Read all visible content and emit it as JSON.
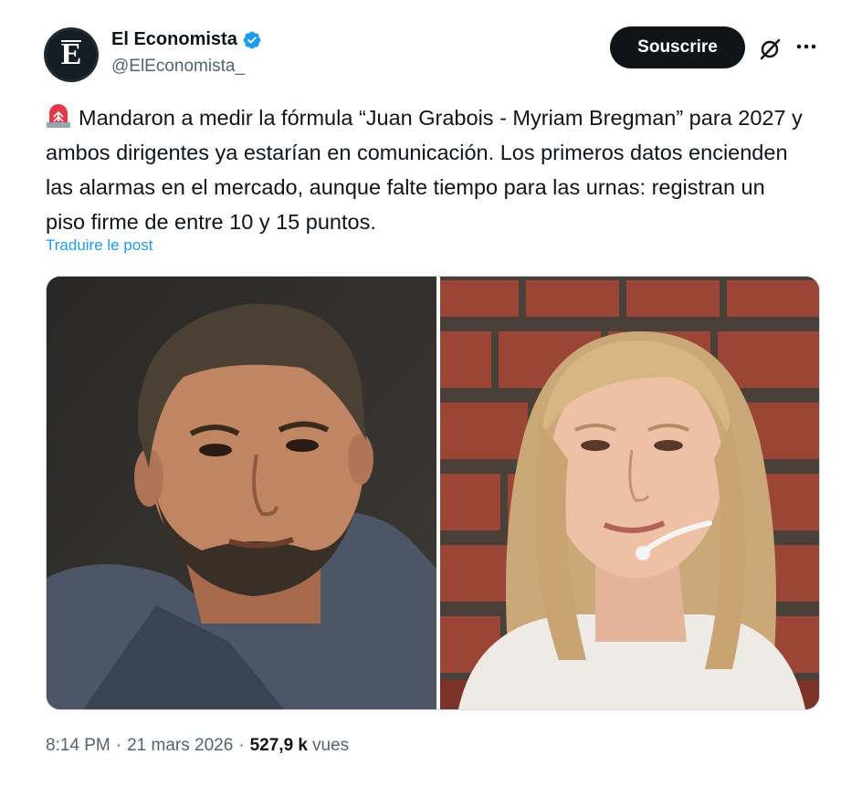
{
  "author": {
    "display_name": "El Economista",
    "handle": "@ElEconomista_",
    "avatar_letter": "E",
    "verified": true
  },
  "actions": {
    "subscribe_label": "Souscrire",
    "grok_icon": "grok-icon",
    "more_icon": "more-icon"
  },
  "tweet": {
    "text": "Mandaron a medir la fórmula “Juan Grabois - Myriam Bregman” para 2027 y ambos dirigentes ya estarían en comunicación. Los primeros datos encienden las alarmas en el mercado, aunque falte tiempo para las urnas: registran un piso firme de entre 10 y 15 puntos.",
    "leading_emoji": "siren-icon",
    "translate_label": "Traduire le post"
  },
  "media": {
    "images": [
      {
        "subject": "man-portrait"
      },
      {
        "subject": "woman-portrait-brick-wall"
      }
    ]
  },
  "meta": {
    "time": "8:14 PM",
    "date": "21 mars 2026",
    "views_count": "527,9 k",
    "views_label": "vues"
  },
  "colors": {
    "accent": "#1d9bf0",
    "text_primary": "#0f1419",
    "text_secondary": "#536471",
    "button_bg": "#0f1419"
  }
}
